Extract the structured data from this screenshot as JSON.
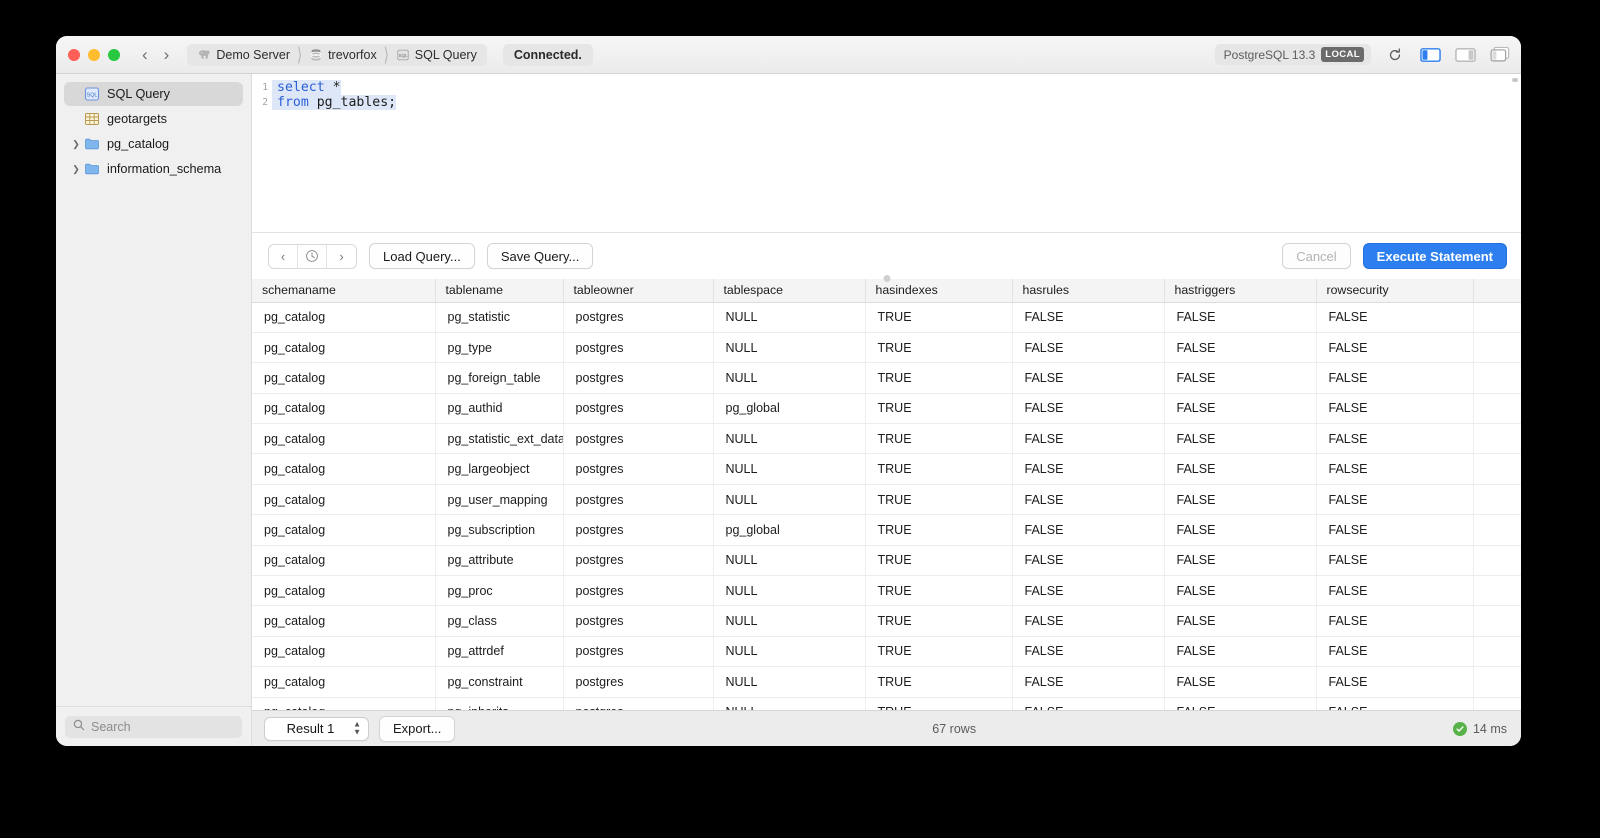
{
  "window": {
    "traffic_lights": [
      "close",
      "minimize",
      "maximize"
    ],
    "nav_back": "‹",
    "nav_forward": "›",
    "breadcrumbs": [
      {
        "label": "Demo Server",
        "icon": "elephant-icon"
      },
      {
        "label": "trevorfox",
        "icon": "database-icon"
      },
      {
        "label": "SQL Query",
        "icon": "sql-file-icon"
      }
    ],
    "status": "Connected.",
    "version": "PostgreSQL 13.3",
    "local_badge": "LOCAL",
    "toolbar_icons": [
      "refresh-icon",
      "left-panel-toggle-icon",
      "right-panel-toggle-icon",
      "tab-overview-icon"
    ]
  },
  "sidebar": {
    "items": [
      {
        "label": "SQL Query",
        "icon": "sql-file-icon",
        "selected": true,
        "expandable": false
      },
      {
        "label": "geotargets",
        "icon": "table-icon",
        "selected": false,
        "expandable": false
      },
      {
        "label": "pg_catalog",
        "icon": "folder-icon",
        "selected": false,
        "expandable": true
      },
      {
        "label": "information_schema",
        "icon": "folder-icon",
        "selected": false,
        "expandable": true
      }
    ],
    "search_placeholder": "Search"
  },
  "editor": {
    "lines": [
      {
        "num": "1",
        "tokens": [
          {
            "t": "select ",
            "kw": true
          },
          {
            "t": "*",
            "kw": false
          }
        ]
      },
      {
        "num": "2",
        "tokens": [
          {
            "t": "from ",
            "kw": true
          },
          {
            "t": "pg_tables;",
            "kw": false
          }
        ]
      }
    ]
  },
  "query_toolbar": {
    "history_prev": "‹",
    "history_clock": "clock-icon",
    "history_next": "›",
    "load_query": "Load Query...",
    "save_query": "Save Query...",
    "cancel": "Cancel",
    "execute": "Execute Statement"
  },
  "results": {
    "columns": [
      "schemaname",
      "tablename",
      "tableowner",
      "tablespace",
      "hasindexes",
      "hasrules",
      "hastriggers",
      "rowsecurity",
      ""
    ],
    "rows": [
      [
        "pg_catalog",
        "pg_statistic",
        "postgres",
        "NULL",
        "TRUE",
        "FALSE",
        "FALSE",
        "FALSE",
        ""
      ],
      [
        "pg_catalog",
        "pg_type",
        "postgres",
        "NULL",
        "TRUE",
        "FALSE",
        "FALSE",
        "FALSE",
        ""
      ],
      [
        "pg_catalog",
        "pg_foreign_table",
        "postgres",
        "NULL",
        "TRUE",
        "FALSE",
        "FALSE",
        "FALSE",
        ""
      ],
      [
        "pg_catalog",
        "pg_authid",
        "postgres",
        "pg_global",
        "TRUE",
        "FALSE",
        "FALSE",
        "FALSE",
        ""
      ],
      [
        "pg_catalog",
        "pg_statistic_ext_data",
        "postgres",
        "NULL",
        "TRUE",
        "FALSE",
        "FALSE",
        "FALSE",
        ""
      ],
      [
        "pg_catalog",
        "pg_largeobject",
        "postgres",
        "NULL",
        "TRUE",
        "FALSE",
        "FALSE",
        "FALSE",
        ""
      ],
      [
        "pg_catalog",
        "pg_user_mapping",
        "postgres",
        "NULL",
        "TRUE",
        "FALSE",
        "FALSE",
        "FALSE",
        ""
      ],
      [
        "pg_catalog",
        "pg_subscription",
        "postgres",
        "pg_global",
        "TRUE",
        "FALSE",
        "FALSE",
        "FALSE",
        ""
      ],
      [
        "pg_catalog",
        "pg_attribute",
        "postgres",
        "NULL",
        "TRUE",
        "FALSE",
        "FALSE",
        "FALSE",
        ""
      ],
      [
        "pg_catalog",
        "pg_proc",
        "postgres",
        "NULL",
        "TRUE",
        "FALSE",
        "FALSE",
        "FALSE",
        ""
      ],
      [
        "pg_catalog",
        "pg_class",
        "postgres",
        "NULL",
        "TRUE",
        "FALSE",
        "FALSE",
        "FALSE",
        ""
      ],
      [
        "pg_catalog",
        "pg_attrdef",
        "postgres",
        "NULL",
        "TRUE",
        "FALSE",
        "FALSE",
        "FALSE",
        ""
      ],
      [
        "pg_catalog",
        "pg_constraint",
        "postgres",
        "NULL",
        "TRUE",
        "FALSE",
        "FALSE",
        "FALSE",
        ""
      ],
      [
        "pg_catalog",
        "pg_inherits",
        "postgres",
        "NULL",
        "TRUE",
        "FALSE",
        "FALSE",
        "FALSE",
        ""
      ]
    ]
  },
  "statusbar": {
    "result_selector": "Result 1",
    "export": "Export...",
    "row_count": "67 rows",
    "duration": "14 ms",
    "status_icon": "success-check-icon"
  },
  "colors": {
    "accent": "#2d7ff0",
    "success": "#57b348",
    "keyword": "#2b5fd9",
    "selection": "#dde7f7"
  }
}
